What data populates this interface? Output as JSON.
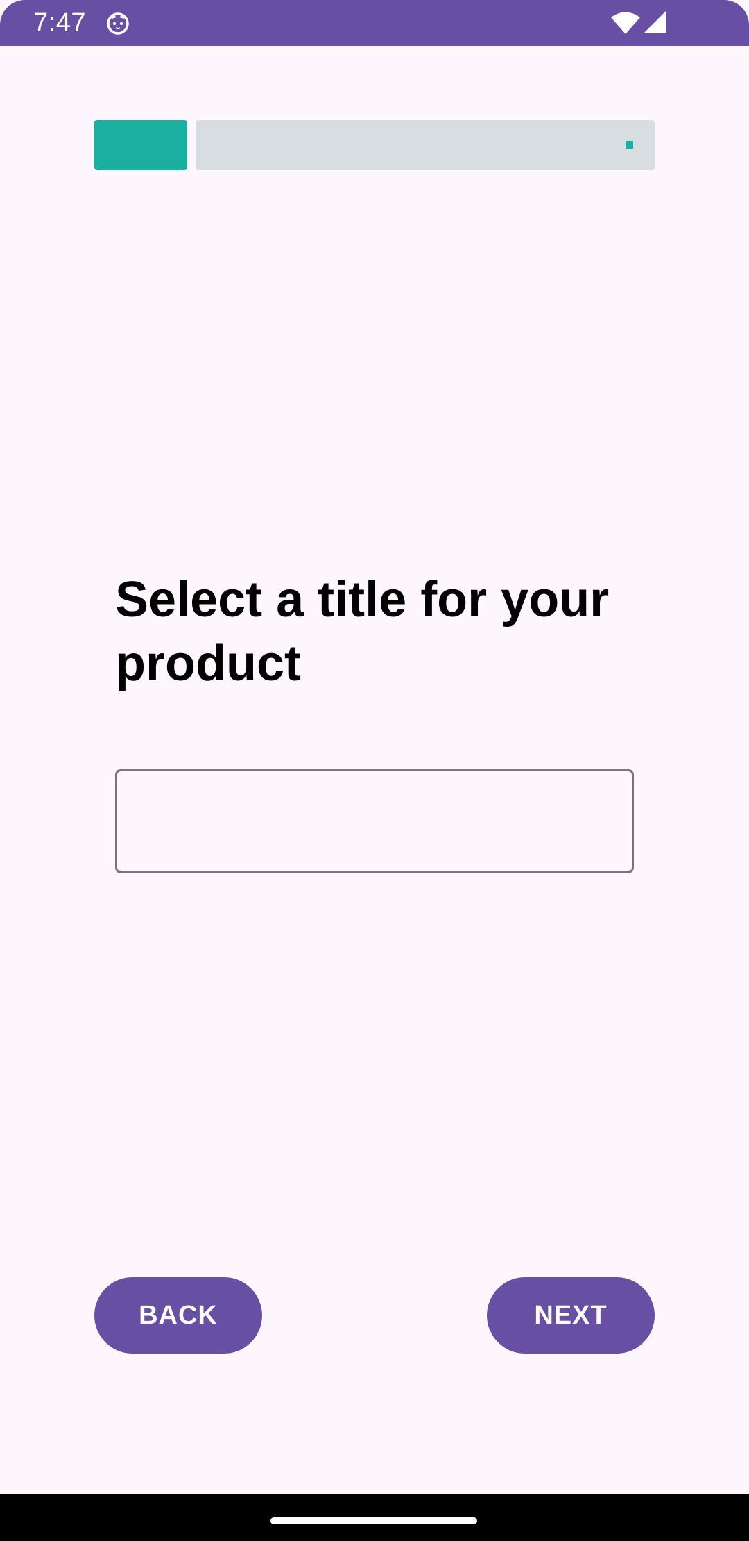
{
  "status_bar": {
    "time": "7:47",
    "icons": [
      "cat-notification-icon",
      "wifi-icon",
      "cell-signal-icon"
    ],
    "background": "#6750a4"
  },
  "progress": {
    "current_step": 1,
    "fraction_complete": 0.2,
    "fill_color": "#1aaf9e",
    "track_color": "#d8dde2"
  },
  "main": {
    "title": "Select a title for your product",
    "title_input": {
      "value": "",
      "placeholder": ""
    }
  },
  "footer": {
    "back_label": "BACK",
    "next_label": "NEXT",
    "button_color": "#6750a4"
  }
}
